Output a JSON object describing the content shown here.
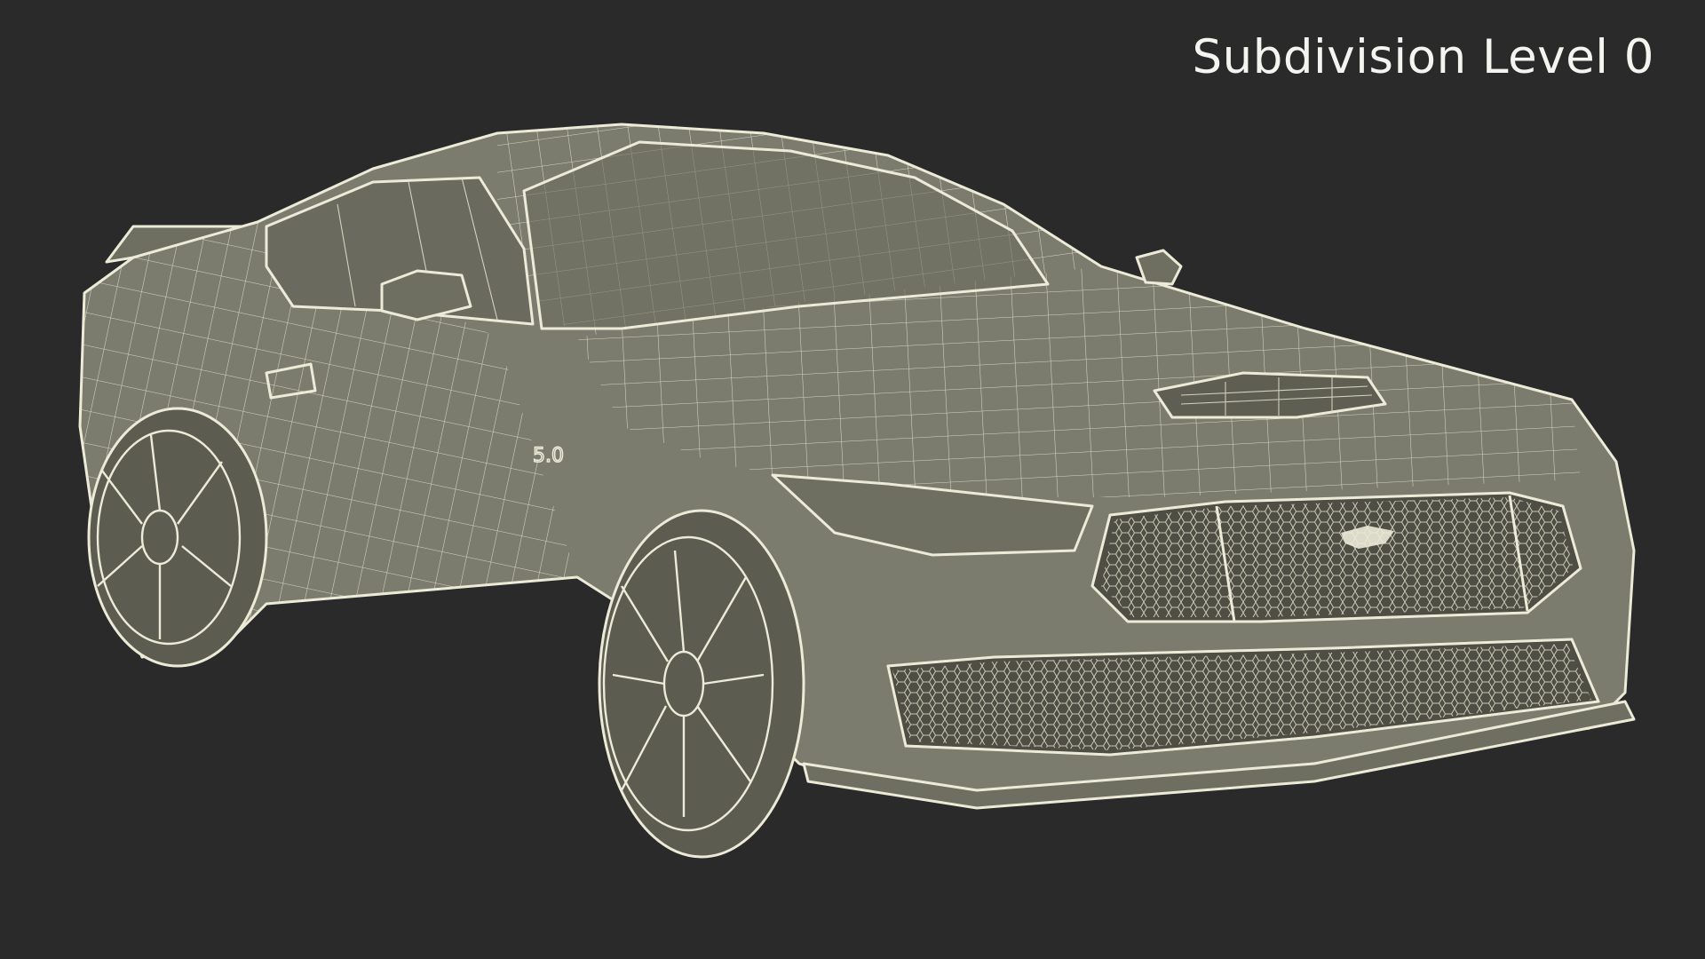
{
  "overlay": {
    "subdivision_label": "Subdivision Level 0"
  },
  "scene": {
    "subject": "car-wireframe-render",
    "background_color": "#2a2a2a",
    "mesh_color": "#7c7c6e",
    "wire_color": "#ecebd8",
    "badge_text": "5.0"
  }
}
